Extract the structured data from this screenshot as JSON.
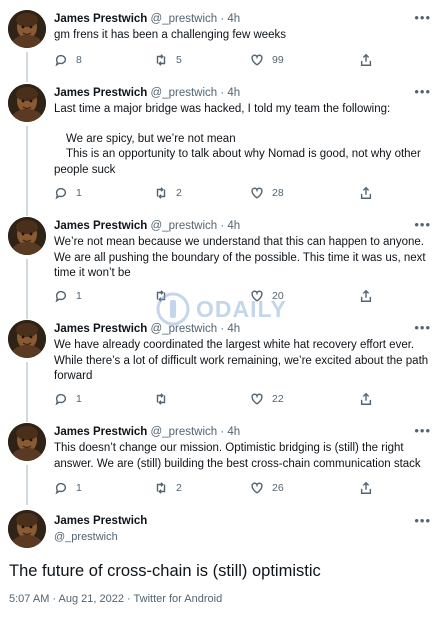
{
  "tweets": [
    {
      "name": "James Prestwich",
      "meta": "@_prestwich · 4h",
      "lines": [
        "gm frens it has been a challenging few weeks"
      ],
      "replies": "8",
      "retweets": "5",
      "likes": "99"
    },
    {
      "name": "James Prestwich",
      "meta": "@_prestwich · 4h",
      "lines": [
        "Last time a major bridge was hacked, I told my team the following:"
      ],
      "indented": [
        "We are spicy, but we’re not mean",
        "This is an opportunity to talk about why Nomad is good, not why other"
      ],
      "tail": "people suck",
      "replies": "1",
      "retweets": "2",
      "likes": "28"
    },
    {
      "name": "James Prestwich",
      "meta": "@_prestwich · 4h",
      "lines": [
        "We’re not mean because we understand that this can happen to anyone.",
        "We are all pushing the boundary of the possible. This time it was us, next",
        "time it won’t be"
      ],
      "replies": "1",
      "retweets": "",
      "likes": "20"
    },
    {
      "name": "James Prestwich",
      "meta": "@_prestwich · 4h",
      "lines": [
        "We have already coordinated the largest white hat recovery effort ever.",
        "While there’s a lot of difficult work remaining, we’re excited about the path",
        "forward"
      ],
      "replies": "1",
      "retweets": "",
      "likes": "22"
    },
    {
      "name": "James Prestwich",
      "meta": "@_prestwich · 4h",
      "lines": [
        "This doesn’t change our mission. Optimistic bridging is (still) the right",
        "answer. We are (still) building the best cross-chain communication stack"
      ],
      "replies": "1",
      "retweets": "2",
      "likes": "26"
    }
  ],
  "final": {
    "name": "James Prestwich",
    "handle": "@_prestwich",
    "text": "The future of cross-chain is (still) optimistic",
    "meta": "5:07 AM · Aug 21, 2022 · Twitter for Android"
  },
  "watermark": "ODAILY",
  "icons": {
    "reply": "reply-icon",
    "retweet": "retweet-icon",
    "like": "like-icon",
    "share": "share-icon",
    "more": "more-icon"
  },
  "colors": {
    "text": "#0f1419",
    "secondary": "#536471",
    "thread_line": "#cfd9de"
  }
}
